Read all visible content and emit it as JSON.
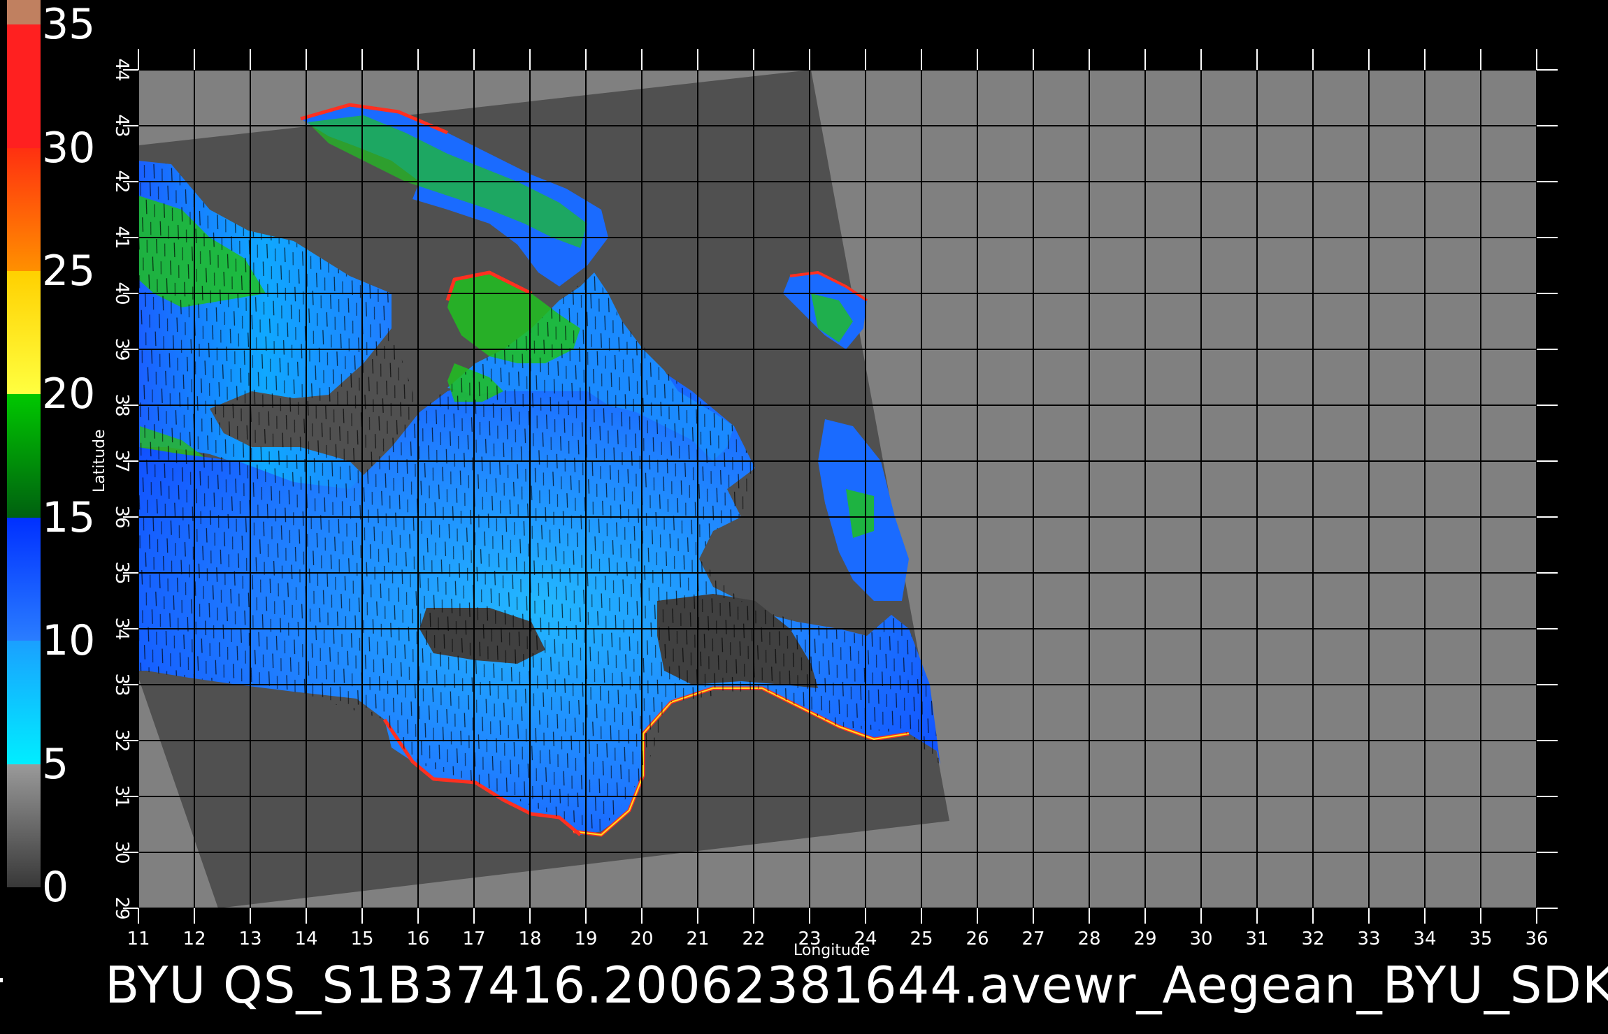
{
  "colorbar": {
    "labels": [
      "35",
      "30",
      "25",
      "20",
      "15",
      "10",
      "5",
      "0"
    ],
    "stops": [
      {
        "from": 0,
        "to": 5,
        "top": "#9a9a9a",
        "bottom": "#383838"
      },
      {
        "from": 5,
        "to": 10,
        "top": "#1aa0ff",
        "bottom": "#00eeff"
      },
      {
        "from": 10,
        "to": 15,
        "top": "#0030ff",
        "bottom": "#2a7dff"
      },
      {
        "from": 15,
        "to": 20,
        "top": "#00c800",
        "bottom": "#006010"
      },
      {
        "from": 20,
        "to": 25,
        "top": "#ffd000",
        "bottom": "#ffff40"
      },
      {
        "from": 25,
        "to": 30,
        "top": "#ff3010",
        "bottom": "#ff9000"
      },
      {
        "from": 30,
        "to": 35,
        "top": "#ff2020",
        "bottom": "#ff2020"
      },
      {
        "from": 35,
        "to": 36,
        "top": "#c08060",
        "bottom": "#c08060"
      }
    ]
  },
  "axes": {
    "xlabel": "Longitude",
    "ylabel": "Latitude",
    "x_ticks": [
      "11",
      "12",
      "13",
      "14",
      "15",
      "16",
      "17",
      "18",
      "19",
      "20",
      "21",
      "22",
      "23",
      "24",
      "25",
      "26",
      "27",
      "28",
      "29",
      "30",
      "31",
      "32",
      "33",
      "34",
      "35",
      "36"
    ],
    "y_ticks": [
      "29",
      "30",
      "31",
      "32",
      "33",
      "34",
      "35",
      "36",
      "37",
      "38",
      "39",
      "40",
      "41",
      "42",
      "43",
      "44"
    ],
    "xlim": [
      11,
      36
    ],
    "ylim": [
      29,
      44
    ]
  },
  "colors": {
    "background": "#000000",
    "nodata": "#808080",
    "swath_land": "#505050",
    "grid": "#000000"
  },
  "footer": {
    "title": "BYU  QS_S1B37416.20062381644.avewr_Aegean_BYU_SDK"
  }
}
